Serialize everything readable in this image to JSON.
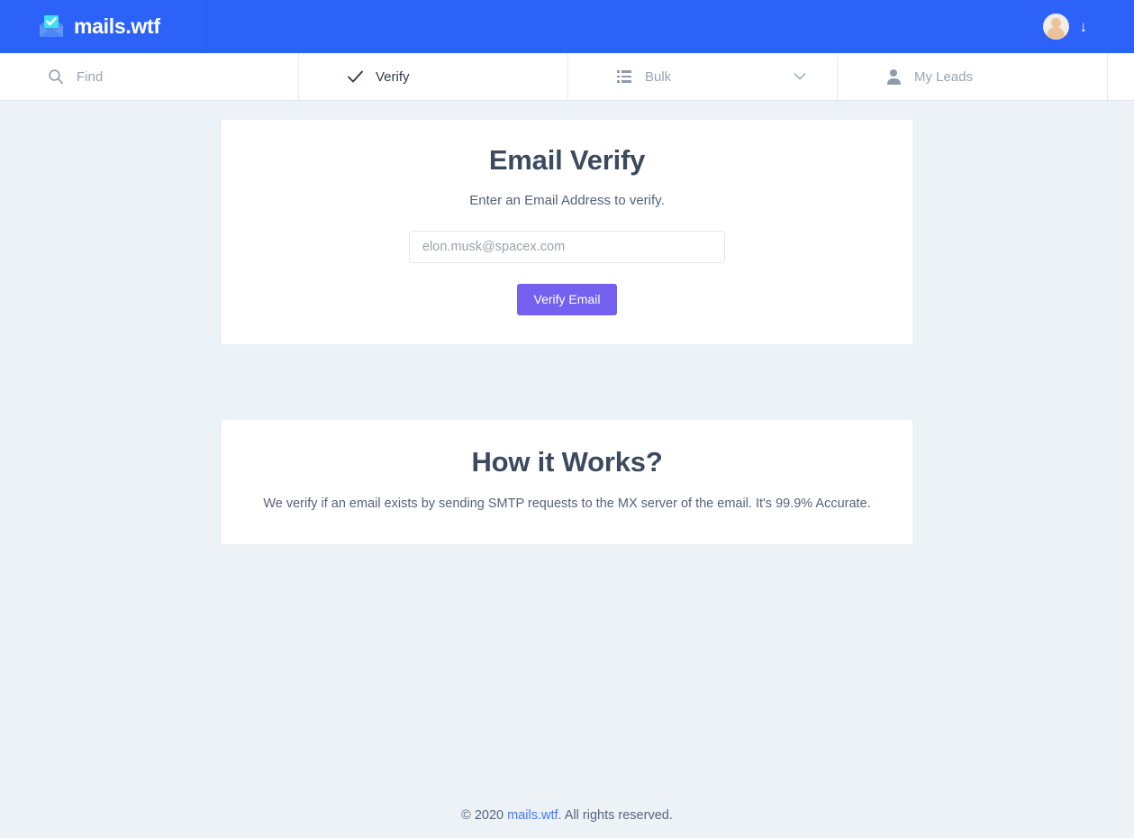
{
  "colors": {
    "header_blue": "#2c62f8",
    "page_bg": "#ecf2f6",
    "card_bg": "#ffffff",
    "button_purple": "#7461ef",
    "heading": "#3c4a5e",
    "muted_text": "#97a4b4",
    "link_blue": "#3e7bfa"
  },
  "header": {
    "brand_name": "mails.wtf",
    "brand_icon": "envelope-check-icon",
    "avatar_icon": "avatar",
    "menu_arrow_icon": "arrow-down-icon",
    "menu_arrow_glyph": "↓"
  },
  "nav": {
    "items": [
      {
        "id": "find",
        "label": "Find",
        "icon": "search-icon",
        "active": false,
        "has_chevron": false
      },
      {
        "id": "verify",
        "label": "Verify",
        "icon": "check-icon",
        "active": true,
        "has_chevron": false
      },
      {
        "id": "bulk",
        "label": "Bulk",
        "icon": "list-icon",
        "active": false,
        "has_chevron": true,
        "chevron_icon": "chevron-down-icon"
      },
      {
        "id": "leads",
        "label": "My Leads",
        "icon": "person-icon",
        "active": false,
        "has_chevron": false
      }
    ]
  },
  "verify_card": {
    "title": "Email Verify",
    "subtitle": "Enter an Email Address to verify.",
    "input_value": "",
    "input_placeholder": "elon.musk@spacex.com",
    "button_label": "Verify Email"
  },
  "how_card": {
    "title": "How it Works?",
    "body": "We verify if an email exists by sending SMTP requests to the MX server of the email. It's 99.9% Accurate."
  },
  "footer": {
    "prefix": "© 2020 ",
    "link_label": "mails.wtf",
    "suffix": ". All rights reserved."
  }
}
